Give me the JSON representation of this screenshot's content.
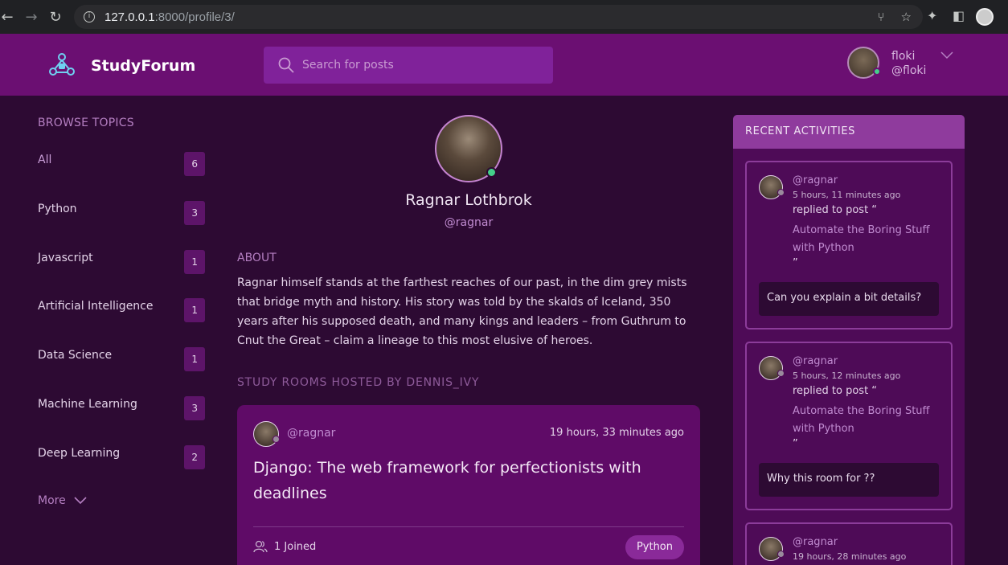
{
  "browser": {
    "url_host": "127.0.0.1",
    "url_path": ":8000/profile/3/"
  },
  "header": {
    "brand": "StudyForum",
    "search_placeholder": "Search for posts",
    "user_name": "floki",
    "user_handle": "@floki",
    "accent_color": "#6b0f72"
  },
  "topics": {
    "heading": "BROWSE TOPICS",
    "items": [
      {
        "label": "All",
        "count": "6"
      },
      {
        "label": "Python",
        "count": "3"
      },
      {
        "label": "Javascript",
        "count": "1"
      },
      {
        "label": "Artificial Intelligence",
        "count": "1"
      },
      {
        "label": "Data Science",
        "count": "1"
      },
      {
        "label": "Machine Learning",
        "count": "3"
      },
      {
        "label": "Deep Learning",
        "count": "2"
      }
    ],
    "more_label": "More"
  },
  "profile": {
    "name": "Ragnar Lothbrok",
    "handle": "@ragnar",
    "about_heading": "ABOUT",
    "about_text": "Ragnar himself stands at the farthest reaches of our past, in the dim grey mists that bridge myth and history. His story was told by the skalds of Iceland, 350 years after his supposed death, and many kings and leaders – from Guthrum to Cnut the Great – claim a lineage to this most elusive of heroes.",
    "rooms_heading": "STUDY ROOMS HOSTED BY DENNIS_IVY"
  },
  "room": {
    "host": "@ragnar",
    "time": "19 hours, 33 minutes ago",
    "title": "Django: The web framework for perfectionists with deadlines",
    "joined": "1 Joined",
    "topic": "Python"
  },
  "activities": {
    "heading": "RECENT ACTIVITIES",
    "items": [
      {
        "user": "@ragnar",
        "ago": "5 hours, 11 minutes ago",
        "action": "replied to post “",
        "post": "Automate the Boring Stuff with Python",
        "close": "”",
        "message": "Can you explain a bit details?"
      },
      {
        "user": "@ragnar",
        "ago": "5 hours, 12 minutes ago",
        "action": "replied to post “",
        "post": "Automate the Boring Stuff with Python",
        "close": "”",
        "message": "Why this room for ??"
      },
      {
        "user": "@ragnar",
        "ago": "19 hours, 28 minutes ago"
      }
    ]
  }
}
